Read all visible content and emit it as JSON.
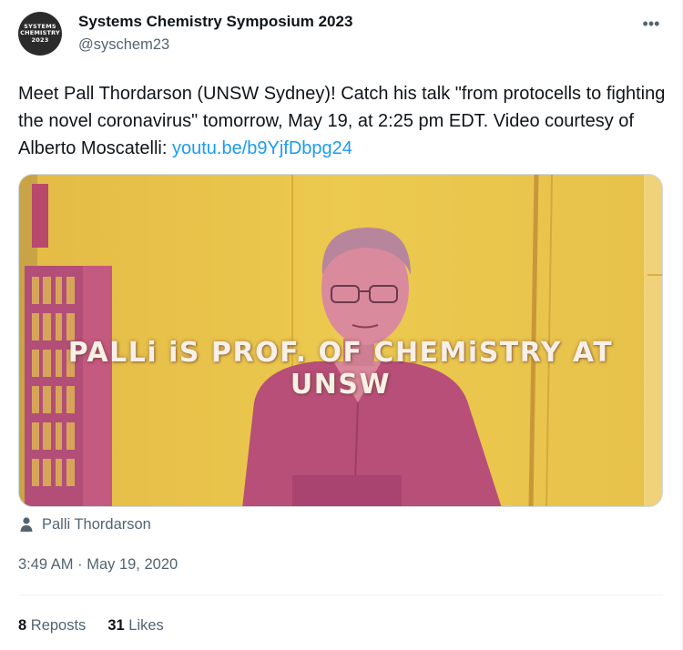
{
  "account": {
    "display_name": "Systems Chemistry Symposium 2023",
    "handle": "@syschem23",
    "avatar_lines": [
      "SYSTEMS",
      "CHEMISTRY",
      "2023"
    ]
  },
  "header": {
    "more_label": "•••"
  },
  "tweet": {
    "text": "Meet Pall Thordarson (UNSW Sydney)! Catch his talk \"from protocells to fighting the novel coronavirus\" tomorrow, May 19, at 2:25 pm EDT. Video courtesy of Alberto Moscatelli: ",
    "link_text": "youtu.be/b9YjfDbpg24"
  },
  "media": {
    "caption": "PALLi iS PROF. OF CHEMiSTRY AT UNSW",
    "colors": {
      "background": "#e9c54a",
      "figure": "#b84f78"
    }
  },
  "tagged": {
    "icon": "person-icon",
    "name": "Palli Thordarson"
  },
  "timestamp": "3:49 AM · May 19, 2020",
  "stats": {
    "reposts_count": "8",
    "reposts_label": "Reposts",
    "likes_count": "31",
    "likes_label": "Likes"
  }
}
